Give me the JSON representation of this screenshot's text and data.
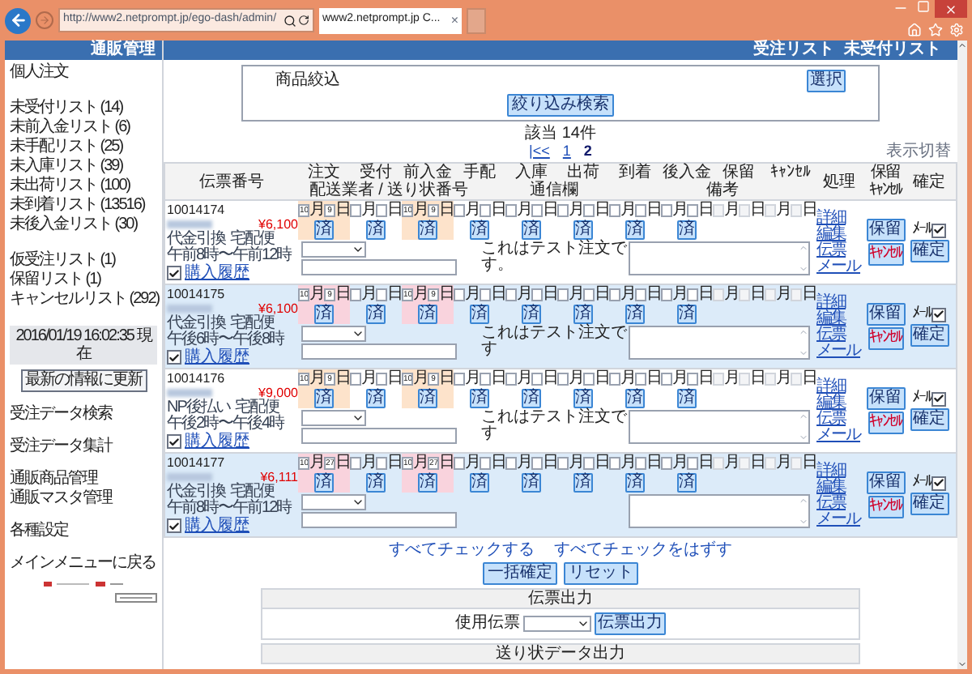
{
  "browser": {
    "address": "http://www2.netprompt.jp/ego-dash/admin/",
    "tab_title": "www2.netprompt.jp C...",
    "close_tab": "×"
  },
  "sidebar": {
    "title": "通販管理",
    "heading": "個人注文",
    "lists": [
      "未受付リスト (14)",
      "未前入金リスト (6)",
      "未手配リスト (25)",
      "未入庫リスト (39)",
      "未出荷リスト (100)",
      "未到着リスト (13516)",
      "未後入金リスト (30)"
    ],
    "sub_lists": [
      "仮受注リスト (1)",
      "保留リスト (1)",
      "キャンセルリスト (292)"
    ],
    "timestamp": "2016/01/19 16:02:35 現在",
    "refresh_button": "最新の情報に更新",
    "menu_groups": [
      [
        "受注データ検索"
      ],
      [
        "受注データ集計"
      ],
      [
        "通販商品管理",
        "通販マスタ管理"
      ],
      [
        "各種設定"
      ],
      [
        "メインメニューに戻る"
      ]
    ]
  },
  "main": {
    "breadcrumb": [
      "受注リスト",
      "未受付リスト"
    ],
    "filter": {
      "label": "商品絞込",
      "select_button": "選択",
      "search_button": "絞り込み検索"
    },
    "count": "該当 14件",
    "pagination": [
      {
        "label": "|<<",
        "selected": false
      },
      {
        "label": "1",
        "selected": false
      },
      {
        "label": "2",
        "selected": true
      }
    ],
    "display_toggle": "表示切替",
    "table": {
      "columns": {
        "order_no": "伝票番号",
        "stages": [
          "注文",
          "受付",
          "前入金",
          "手配",
          "入庫",
          "出荷",
          "到着",
          "後入金",
          "保留",
          "ｷｬﾝｾﾙ"
        ],
        "sub": [
          "配送業者 / 送り状番号",
          "通信欄",
          "備考"
        ],
        "process": "処理",
        "hold": [
          "保留",
          "ｷｬﾝｾﾙ"
        ],
        "confirm": "確定"
      },
      "rows": [
        {
          "shaded": false,
          "checked": true,
          "order_no": "10014174",
          "price": "¥6,100",
          "payment": [
            "代金引換",
            "宅配便",
            "午前8時〜午前12時"
          ],
          "history_link": "購入履歴",
          "comment": "これはテスト注文です。",
          "actions": [
            "詳細",
            "編集",
            "伝票",
            "メール"
          ],
          "hold_button": "保留",
          "cancel_button": "ｷｬﾝｾﾙ",
          "mail_label": "ﾒｰﾙ",
          "mail_checked": true,
          "confirm_button": "確定",
          "stages": [
            {
              "month": "10",
              "day": "9",
              "month_label": "月",
              "day_label": "日",
              "done": "済",
              "color": "#fde3cb",
              "disabled": false
            },
            {
              "month_label": "月",
              "day_label": "日",
              "done": "済",
              "disabled": false
            },
            {
              "month": "10",
              "day": "9",
              "month_label": "月",
              "day_label": "日",
              "done": "済",
              "color": "#fde3cb",
              "disabled": false
            },
            {
              "month_label": "月",
              "day_label": "日",
              "done": "済",
              "disabled": false
            },
            {
              "month_label": "月",
              "day_label": "日",
              "done": "済",
              "disabled": false
            },
            {
              "month_label": "月",
              "day_label": "日",
              "done": "済",
              "disabled": false
            },
            {
              "month_label": "月",
              "day_label": "日",
              "done": "済",
              "disabled": false
            },
            {
              "month_label": "月",
              "day_label": "日",
              "done": "済",
              "disabled": false
            },
            {
              "month_label": "月",
              "day_label": "日",
              "disabled": true
            },
            {
              "month_label": "月",
              "day_label": "日",
              "disabled": true
            }
          ]
        },
        {
          "shaded": true,
          "checked": true,
          "order_no": "10014175",
          "price": "¥6,100",
          "payment": [
            "代金引換",
            "宅配便",
            "午後6時〜午後8時"
          ],
          "history_link": "購入履歴",
          "comment": "これはテスト注文です",
          "actions": [
            "詳細",
            "編集",
            "伝票",
            "メール"
          ],
          "hold_button": "保留",
          "cancel_button": "ｷｬﾝｾﾙ",
          "mail_label": "ﾒｰﾙ",
          "mail_checked": true,
          "confirm_button": "確定",
          "stages": [
            {
              "month": "10",
              "day": "9",
              "month_label": "月",
              "day_label": "日",
              "done": "済",
              "color": "#f9d3dd",
              "disabled": false
            },
            {
              "month_label": "月",
              "day_label": "日",
              "done": "済",
              "disabled": false
            },
            {
              "month": "10",
              "day": "9",
              "month_label": "月",
              "day_label": "日",
              "done": "済",
              "color": "#f9d3dd",
              "disabled": false
            },
            {
              "month_label": "月",
              "day_label": "日",
              "done": "済",
              "disabled": false
            },
            {
              "month_label": "月",
              "day_label": "日",
              "done": "済",
              "disabled": false
            },
            {
              "month_label": "月",
              "day_label": "日",
              "done": "済",
              "disabled": false
            },
            {
              "month_label": "月",
              "day_label": "日",
              "done": "済",
              "disabled": false
            },
            {
              "month_label": "月",
              "day_label": "日",
              "done": "済",
              "disabled": false
            },
            {
              "month_label": "月",
              "day_label": "日",
              "disabled": true
            },
            {
              "month_label": "月",
              "day_label": "日",
              "disabled": true
            }
          ]
        },
        {
          "shaded": false,
          "checked": true,
          "order_no": "10014176",
          "price": "¥9,000",
          "payment": [
            "NP後払い",
            "宅配便",
            "午後2時〜午後4時"
          ],
          "history_link": "購入履歴",
          "comment": "これはテスト注文です",
          "actions": [
            "詳細",
            "編集",
            "伝票",
            "メール"
          ],
          "hold_button": "保留",
          "cancel_button": "ｷｬﾝｾﾙ",
          "mail_label": "ﾒｰﾙ",
          "mail_checked": true,
          "confirm_button": "確定",
          "stages": [
            {
              "month": "10",
              "day": "9",
              "month_label": "月",
              "day_label": "日",
              "done": "済",
              "color": "#fde3cb",
              "disabled": false
            },
            {
              "month_label": "月",
              "day_label": "日",
              "done": "済",
              "disabled": false
            },
            {
              "month": "10",
              "day": "9",
              "month_label": "月",
              "day_label": "日",
              "done": "済",
              "color": "#fde3cb",
              "disabled": false
            },
            {
              "month_label": "月",
              "day_label": "日",
              "done": "済",
              "disabled": false
            },
            {
              "month_label": "月",
              "day_label": "日",
              "done": "済",
              "disabled": false
            },
            {
              "month_label": "月",
              "day_label": "日",
              "done": "済",
              "disabled": false
            },
            {
              "month_label": "月",
              "day_label": "日",
              "done": "済",
              "disabled": false
            },
            {
              "month_label": "月",
              "day_label": "日",
              "done": "済",
              "disabled": false
            },
            {
              "month_label": "月",
              "day_label": "日",
              "disabled": true
            },
            {
              "month_label": "月",
              "day_label": "日",
              "disabled": true
            }
          ]
        },
        {
          "shaded": true,
          "checked": true,
          "order_no": "10014177",
          "price": "¥6,111",
          "payment": [
            "代金引換",
            "宅配便",
            "午前8時〜午前12時"
          ],
          "history_link": "購入履歴",
          "actions": [
            "詳細",
            "編集",
            "伝票",
            "メール"
          ],
          "hold_button": "保留",
          "cancel_button": "ｷｬﾝｾﾙ",
          "mail_label": "ﾒｰﾙ",
          "mail_checked": true,
          "confirm_button": "確定",
          "stages": [
            {
              "month": "10",
              "day": "27",
              "month_label": "月",
              "day_label": "日",
              "done": "済",
              "color": "#f9d3dd",
              "disabled": false
            },
            {
              "month_label": "月",
              "day_label": "日",
              "done": "済",
              "disabled": false
            },
            {
              "month": "10",
              "day": "27",
              "month_label": "月",
              "day_label": "日",
              "done": "済",
              "color": "#f9d3dd",
              "disabled": false
            },
            {
              "month_label": "月",
              "day_label": "日",
              "done": "済",
              "disabled": false
            },
            {
              "month_label": "月",
              "day_label": "日",
              "done": "済",
              "disabled": false
            },
            {
              "month_label": "月",
              "day_label": "日",
              "done": "済",
              "disabled": false
            },
            {
              "month_label": "月",
              "day_label": "日",
              "done": "済",
              "disabled": false
            },
            {
              "month_label": "月",
              "day_label": "日",
              "done": "済",
              "disabled": false
            },
            {
              "month_label": "月",
              "day_label": "日",
              "disabled": true
            },
            {
              "month_label": "月",
              "day_label": "日",
              "disabled": true
            }
          ]
        }
      ]
    },
    "check_all": "すべてチェックする",
    "uncheck_all": "すべてチェックをはずす",
    "buttons": [
      "一括確定",
      "リセット"
    ],
    "slip_panel": {
      "title": "伝票出力",
      "label": "使用伝票",
      "button": "伝票出力"
    },
    "next_panel_title": "送り状データ出力"
  }
}
